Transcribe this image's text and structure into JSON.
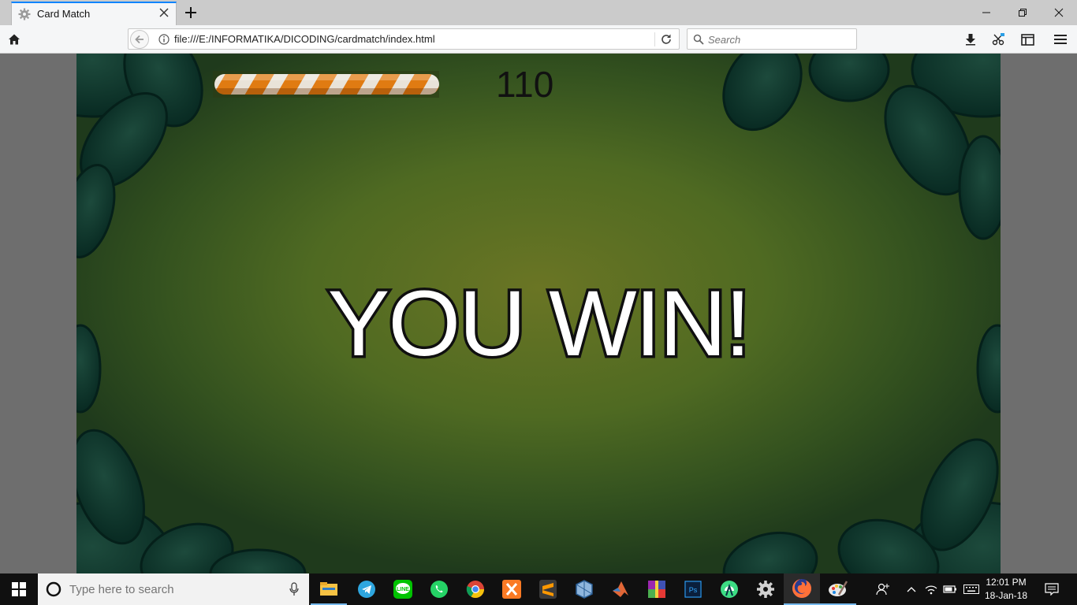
{
  "browser": {
    "tab_title": "Card Match",
    "url": "file:///E:/INFORMATIKA/DICODING/cardmatch/index.html",
    "search_placeholder": "Search"
  },
  "game": {
    "score": "110",
    "timer_fill": 1.0,
    "message": "YOU WIN!"
  },
  "taskbar": {
    "search_placeholder": "Type here to search",
    "apps": [
      "file-explorer-icon",
      "telegram-icon",
      "line-icon",
      "whatsapp-icon",
      "chrome-icon",
      "xampp-icon",
      "sublime-icon",
      "virtualbox-icon",
      "matlab-icon",
      "winrar-icon",
      "photoshop-icon",
      "android-studio-icon",
      "settings-icon",
      "firefox-icon",
      "paint-icon"
    ],
    "time": "12:01 PM",
    "date": "18-Jan-18"
  },
  "colors": {
    "game_bg_center": "#6a7524",
    "game_bg_edge": "#1f3a1c",
    "leaf": "#0f3a2e",
    "timer_orange": "#e07b12",
    "accent": "#0a84ff"
  }
}
